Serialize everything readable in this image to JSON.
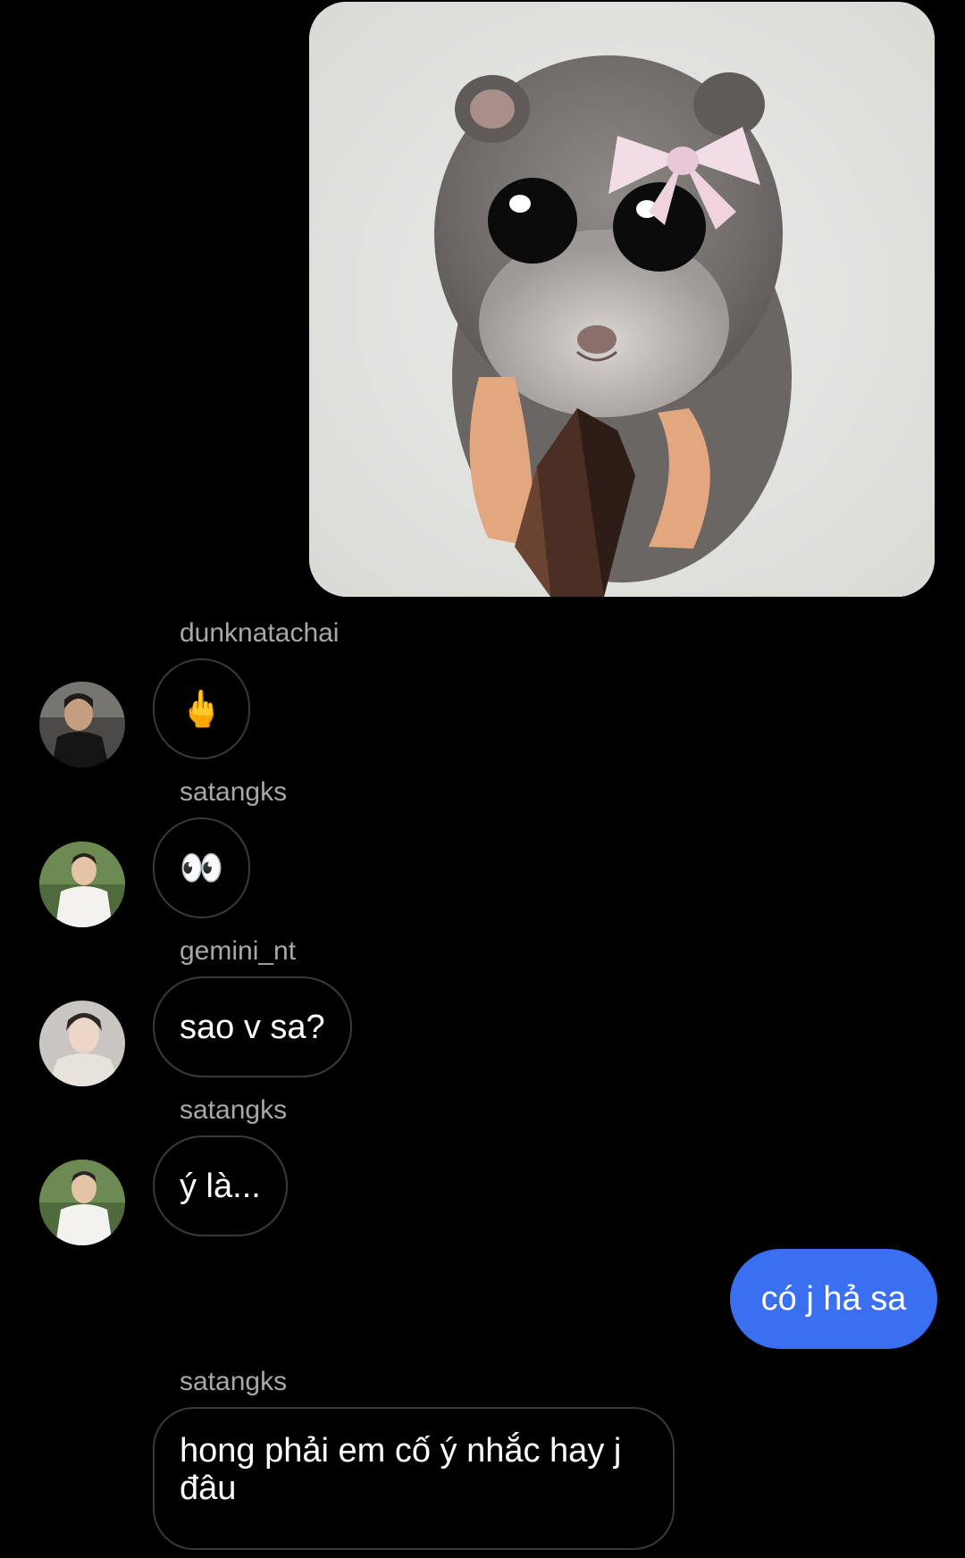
{
  "conversation": {
    "messages": [
      {
        "sender": "dunknatachai",
        "content": "🖕"
      },
      {
        "sender": "satangks",
        "content": "👀"
      },
      {
        "sender": "gemini_nt",
        "content": "sao v sa?"
      },
      {
        "sender": "satangks",
        "content": "ý là..."
      },
      {
        "sender": "satangks",
        "content": "hong phải em cố ý nhắc hay j đâu"
      }
    ],
    "outgoing": {
      "content": "có j hả sa"
    }
  },
  "colors": {
    "background": "#000000",
    "outgoing_bubble": "#3a6ff2",
    "incoming_border": "#3a3a3a",
    "sender_text": "#a8a8a8"
  },
  "icons": {
    "shared_image": "hamster-with-bow-holding-wallet-image",
    "avatar": "user-avatar"
  }
}
